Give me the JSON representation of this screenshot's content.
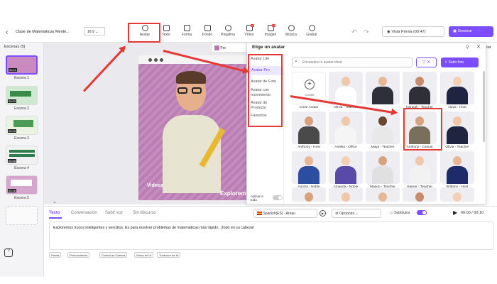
{
  "header": {
    "back": "‹",
    "project_title": "Clase de Matemáticas Mente...",
    "aspect": "16:9",
    "preview": "Vista Previa (00:47)",
    "generate": "Generar"
  },
  "toolbar": [
    {
      "label": "Avatar"
    },
    {
      "label": "Texto"
    },
    {
      "label": "Forma"
    },
    {
      "label": "Fondo"
    },
    {
      "label": "Pegatina"
    },
    {
      "label": "Vídeo"
    },
    {
      "label": "Imagen"
    },
    {
      "label": "Música"
    },
    {
      "label": "Grabar"
    }
  ],
  "scenes": {
    "title": "Escenas (5)",
    "items": [
      {
        "label": "Escena 1",
        "time": "00:11"
      },
      {
        "label": "Escena 2",
        "time": "00:03"
      },
      {
        "label": "Escena 3",
        "time": "00:09"
      },
      {
        "label": "Escena 4",
        "time": "00:08"
      },
      {
        "label": "Escena 5",
        "time": "00:16"
      }
    ]
  },
  "canvas": {
    "watermark": "Vidnoz",
    "caption": "Exploremo",
    "right_cut": "ltar",
    "por": "Por"
  },
  "panel": {
    "title": "Elige un avatar",
    "categories": [
      "Avatar Lite",
      "Avatar Pro",
      "Avatar de Foto",
      "Avatar con movimiento",
      "Avatar de Producto",
      "Favoritos"
    ],
    "search_placeholder": "Encuentra tu avatar ideal",
    "upload": "Subir foto",
    "apply_all": "Aplicar a todo",
    "create": "Crear Avatar",
    "avatars": [
      "Olivia - Teacher",
      "",
      "Hannah - Teacher",
      "Nova - Host",
      "Anthony - Host",
      "Amelia - Office",
      "Maya - Teacher",
      "Anthony - Casual",
      "Olivia - Teacher",
      "Aurora - Noble",
      "Amanda - Noble",
      "Mason - Teacher",
      "Harper - Teacher",
      "Brittany - Host",
      "",
      "",
      "",
      "",
      "",
      ""
    ]
  },
  "bottom": {
    "tabs": [
      "Texto",
      "Conversación",
      "Subir voz",
      "Sin discurso"
    ],
    "voice": "Spanish(ES) - Arnau",
    "options": "Opciones",
    "subtitles": "Subtítulos",
    "time": "00:00 / 00:10",
    "script": "Exploremos trucos inteligentes y sencillos. Es para resolver problemas de matemáticas más rápido. ¡Todo en su cabeza!",
    "chips": [
      "Pausa",
      "Pronunciación",
      "Control de Cabeza",
      "Guión de IA",
      "Traductor de IA"
    ]
  },
  "colors": {
    "accent": "#7c4dff",
    "arrow": "#e53935"
  }
}
